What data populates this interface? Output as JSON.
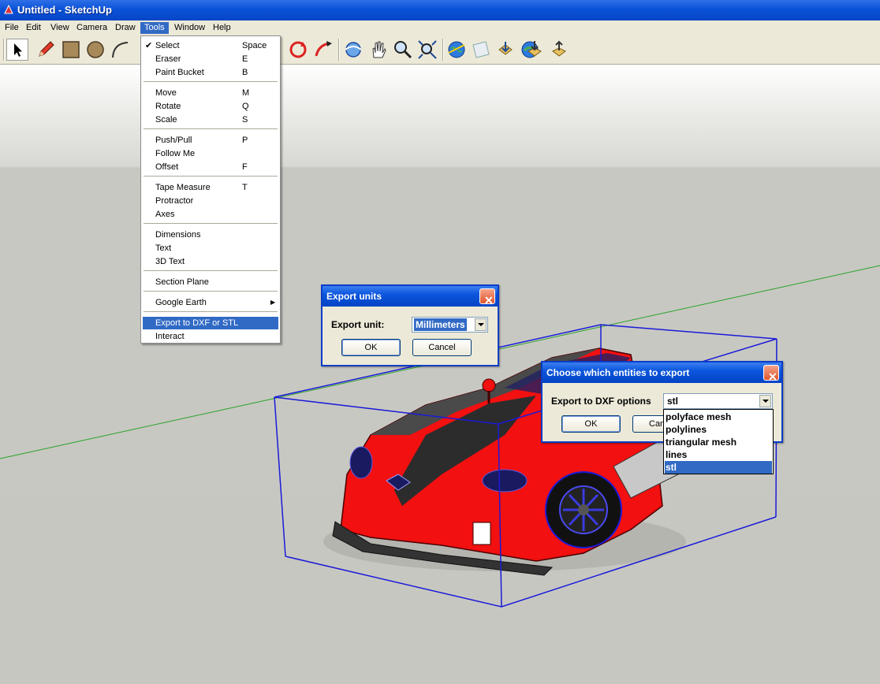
{
  "window": {
    "title": "Untitled - SketchUp"
  },
  "menubar": [
    "File",
    "Edit",
    "View",
    "Camera",
    "Draw",
    "Tools",
    "Window",
    "Help"
  ],
  "toolbar": {
    "icons": [
      "select-arrow-icon",
      "pencil-icon",
      "rectangle-icon",
      "circle-icon",
      "arc-icon",
      "move-icon",
      "rotate-icon",
      "follow-me-icon",
      "orbit-icon",
      "pan-icon",
      "zoom-icon",
      "zoom-extents-icon",
      "google-earth-icon",
      "texture-icon",
      "place-model-icon",
      "get-models-icon",
      "share-model-icon"
    ]
  },
  "tools_menu": {
    "groups": [
      [
        {
          "label": "Select",
          "key": "Space",
          "checked": true
        },
        {
          "label": "Eraser",
          "key": "E"
        },
        {
          "label": "Paint Bucket",
          "key": "B"
        }
      ],
      [
        {
          "label": "Move",
          "key": "M"
        },
        {
          "label": "Rotate",
          "key": "Q"
        },
        {
          "label": "Scale",
          "key": "S"
        }
      ],
      [
        {
          "label": "Push/Pull",
          "key": "P"
        },
        {
          "label": "Follow Me",
          "key": ""
        },
        {
          "label": "Offset",
          "key": "F"
        }
      ],
      [
        {
          "label": "Tape Measure",
          "key": "T"
        },
        {
          "label": "Protractor",
          "key": ""
        },
        {
          "label": "Axes",
          "key": ""
        }
      ],
      [
        {
          "label": "Dimensions",
          "key": ""
        },
        {
          "label": "Text",
          "key": ""
        },
        {
          "label": "3D Text",
          "key": ""
        }
      ],
      [
        {
          "label": "Section Plane",
          "key": ""
        }
      ],
      [
        {
          "label": "Google Earth",
          "key": "",
          "submenu": true
        }
      ],
      [
        {
          "label": "Export to DXF or STL",
          "key": "",
          "highlighted": true
        },
        {
          "label": "Interact",
          "key": ""
        }
      ]
    ]
  },
  "export_units_dialog": {
    "title": "Export units",
    "label": "Export unit:",
    "value": "Millimeters",
    "ok": "OK",
    "cancel": "Cancel"
  },
  "entities_dialog": {
    "title": "Choose which entities to export",
    "label": "Export to DXF options",
    "value": "stl",
    "ok": "OK",
    "cancel_partial": "Can",
    "options": [
      "polyface mesh",
      "polylines",
      "triangular mesh",
      "lines",
      "stl"
    ],
    "selected_index": 4
  },
  "colors": {
    "selection": "#316ac5",
    "xp_title": "#0a52d8",
    "car_body": "#f21010",
    "bounding_box": "#1a1ad8",
    "axis_green": "#27a327"
  }
}
